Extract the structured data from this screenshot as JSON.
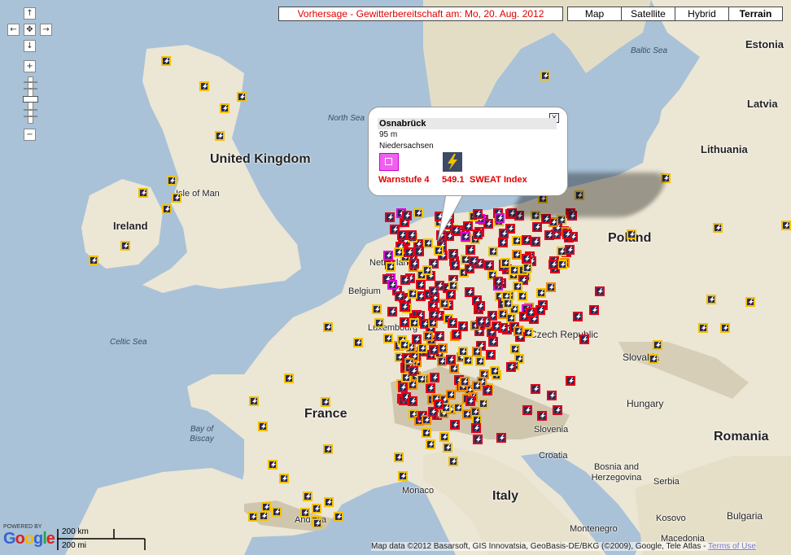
{
  "forecast_title": "Vorhersage - Gewitterbereitschaft am: Mo, 20. Aug. 2012",
  "map_types": [
    {
      "label": "Map",
      "active": false
    },
    {
      "label": "Satellite",
      "active": false
    },
    {
      "label": "Hybrid",
      "active": false
    },
    {
      "label": "Terrain",
      "active": true
    }
  ],
  "controls": {
    "pan_up": "↑",
    "pan_left": "←",
    "pan_center": "✥",
    "pan_right": "→",
    "pan_down": "↓",
    "zoom_in": "+",
    "zoom_out": "−"
  },
  "popup": {
    "title": "Osnabrück",
    "elevation": "95 m",
    "region": "Niedersachsen",
    "warn_label": "Warnstufe 4",
    "sweat_value": "549.1",
    "sweat_label": "SWEAT Index",
    "close_icon": "close-icon"
  },
  "places": {
    "united_kingdom": "United Kingdom",
    "ireland": "Ireland",
    "isle_of_man": "Isle of Man",
    "north_sea": "North Sea",
    "baltic_sea": "Baltic Sea",
    "celtic_sea": "Celtic Sea",
    "bay_of_biscay": "Bay of Biscay",
    "estonia": "Estonia",
    "latvia": "Latvia",
    "lithuania": "Lithuania",
    "poland": "Poland",
    "netherlands": "Netherlands",
    "belgium": "Belgium",
    "luxembourg": "Luxembourg",
    "czech_republic": "Czech Republic",
    "slovakia": "Slovakia",
    "hungary": "Hungary",
    "romania": "Romania",
    "france": "France",
    "slovenia": "Slovenia",
    "croatia": "Croatia",
    "bosnia": "Bosnia and Herzegovina",
    "serbia": "Serbia",
    "italy": "Italy",
    "monaco": "Monaco",
    "andorra": "Andorra",
    "montenegro": "Montenegro",
    "kosovo": "Kosovo",
    "bulgaria": "Bulgaria",
    "macedonia": "Macedonia"
  },
  "scale": {
    "km": "200 km",
    "mi": "200 mi"
  },
  "powered_by": "POWERED BY",
  "google_logo": "Google",
  "attribution": "Map data ©2012 Basarsoft, GIS Innovatsia, GeoBasis-DE/BKG (©2009), Google, Tele Atlas -",
  "terms_link": "Terms of Use",
  "colors": {
    "sea": "#a9c2d8",
    "land": "#ece6d4",
    "title_red": "#e00000",
    "marker_yellow": "#f2c200",
    "marker_orange": "#f08c00",
    "marker_red": "#e0001a",
    "marker_magenta": "#e000e0"
  },
  "marker_icon": "lightning-icon"
}
